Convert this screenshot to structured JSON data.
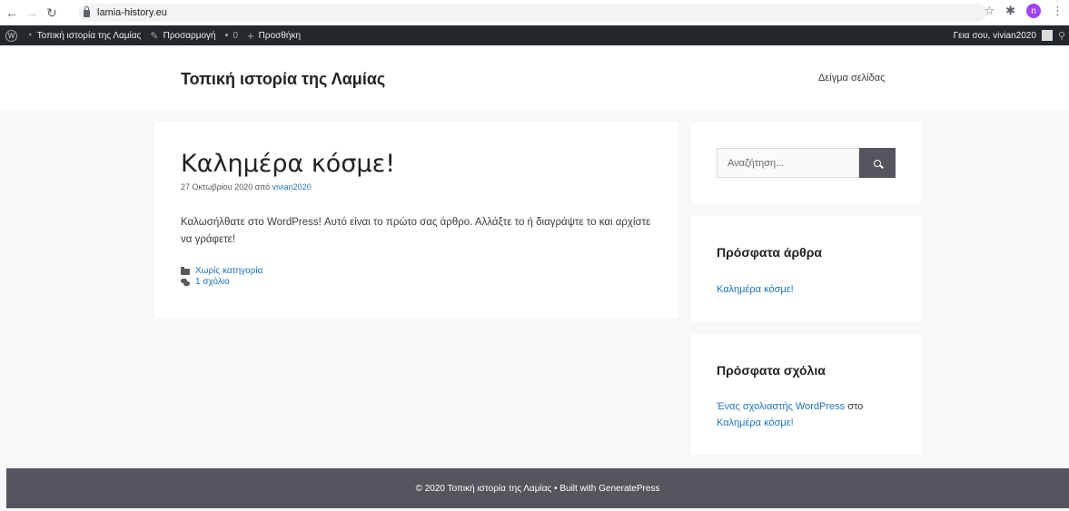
{
  "browser": {
    "url": "lamia-history.eu",
    "avatar_letter": "n"
  },
  "adminbar": {
    "site_name": "Τοπική ιστορία της Λαμίας",
    "customize": "Προσαρμογή",
    "comments_count": "0",
    "add_new": "Προσθήκη",
    "greeting": "Γεια σου, vivian2020"
  },
  "header": {
    "site_title": "Τοπική ιστορία της Λαμίας",
    "menu_item": "Δείγμα σελίδας"
  },
  "post": {
    "title": "Καλημέρα κόσμε!",
    "date": "27 Οκτωβρίου 2020",
    "by": "από",
    "author": "vivian2020",
    "body": "Καλωσήλθατε στο WordPress! Αυτό είναι το πρώτο σας άρθρο. Αλλάξτε το ή διαγράψτε το και αρχίστε να γράφετε!",
    "category": "Χωρίς κατηγορία",
    "comments_link": "1 σχόλιο"
  },
  "sidebar": {
    "search_placeholder": "Αναζήτηση...",
    "recent_posts_title": "Πρόσφατα άρθρα",
    "recent_post_1": "Καλημέρα κόσμε!",
    "recent_comments_title": "Πρόσφατα σχόλια",
    "comment_author": "Ένας σχολιαστής WordPress",
    "comment_on": "στο",
    "comment_post": "Καλημέρα κόσμε!"
  },
  "footer": {
    "text": "© 2020 Τοπική ιστορία της Λαμίας • Built with GeneratePress"
  },
  "colors": {
    "link": "#1e73be",
    "admin_bar": "#23282d",
    "footer": "#55555e",
    "background": "#f7f8f9"
  }
}
